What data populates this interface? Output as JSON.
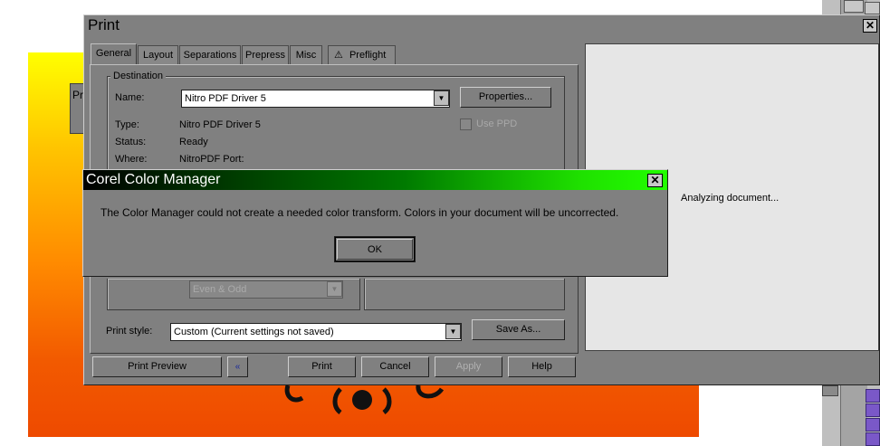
{
  "background": {
    "toolbar_label": "Pr"
  },
  "dialog": {
    "title": "Print",
    "tabs": [
      {
        "label": "General"
      },
      {
        "label": "Layout"
      },
      {
        "label": "Separations"
      },
      {
        "label": "Prepress"
      },
      {
        "label": "Misc"
      },
      {
        "label": "Preflight"
      }
    ],
    "destination": {
      "group_label": "Destination",
      "name_label": "Name:",
      "name_value": "Nitro PDF Driver 5",
      "properties_button": "Properties...",
      "use_ppd_label": "Use PPD",
      "type_label": "Type:",
      "type_value": "Nitro PDF Driver 5",
      "status_label": "Status:",
      "status_value": "Ready",
      "where_label": "Where:",
      "where_value": "NitroPDF Port:"
    },
    "print_range": {
      "even_odd_value": "Even & Odd"
    },
    "print_style": {
      "label": "Print style:",
      "value": "Custom (Current settings not saved)",
      "save_as_button": "Save As..."
    },
    "preview": {
      "status_text": "Analyzing document..."
    },
    "buttons": {
      "print_preview": "Print Preview",
      "print": "Print",
      "cancel": "Cancel",
      "apply": "Apply",
      "help": "Help"
    }
  },
  "message_box": {
    "title": "Corel Color Manager",
    "message": "The Color Manager could not create a needed color transform. Colors in your document will be uncorrected.",
    "ok_button": "OK"
  },
  "colors": {
    "dialog_face": "#808080",
    "preview_bg": "#e6e6e6",
    "msg_title_gradient_end": "#22ff00"
  }
}
